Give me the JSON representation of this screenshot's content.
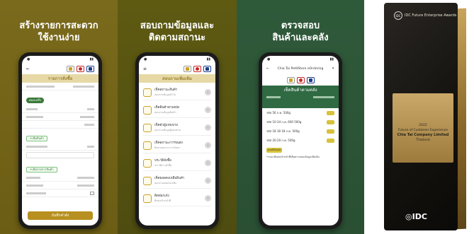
{
  "panels": [
    {
      "heading": [
        "สร้างรายการสะดวก",
        "ใช้งานง่าย"
      ],
      "screen": {
        "title": "รายการสั่งซื้อ",
        "chip": "คนละครึ่ง",
        "btn1": "+เพิ่มสินค้า",
        "btn2": "+เพิ่มรายการสินค้า",
        "primary": "บันทึกคำสั่ง"
      }
    },
    {
      "heading": [
        "สอบถามข้อมูลและ",
        "ติดตามสถานะ"
      ],
      "screen": {
        "title": "สอบถามเพิ่มเติม",
        "items": [
          {
            "label": "เช็คสถานะสินค้า",
            "sub": "สอบถามข้อมูลทั่วไป"
          },
          {
            "label": "เช็คสินค้าตามคลัง",
            "sub": "สอบถามข้อมูลสินค้า"
          },
          {
            "label": "เช็คตัวผู้แทนขาย",
            "sub": "สอบถามข้อมูลผู้แทนขาย"
          },
          {
            "label": "เช็คสถานะการขนส่ง",
            "sub": "ติดตามสถานะการจัดส่ง"
          },
          {
            "label": "ประวัติสั่งซื้อ",
            "sub": "ประวัติการสั่งซื้อ"
          },
          {
            "label": "เช็คยอดคงเหลือสินค้า",
            "sub": "สอบถามยอดคงเหลือ"
          },
          {
            "label": "ติดต่อ/แจ้ง",
            "sub": "ติดต่อเจ้าหน้าที่"
          }
        ]
      }
    },
    {
      "heading": [
        "ตรวจสอบ",
        "สินค้าและคลัง"
      ],
      "screen": {
        "app_title": "Chia Tai PetitStore eOrdering",
        "title": "เช็คสินค้าตามคลัง",
        "rows": [
          "รหัส 56 ก.ค. 500g",
          "รหัส 10-34 ก.ค. 600 500g",
          "รหัส 18 18 18 ก.ค. 500g",
          "รหัส 20-20 ก.ค. 500g"
        ],
        "section": "คงเหลือในคลัง",
        "note": "*กรุณาติดต่อเจ้าหน้าที่เพื่อตรวจสอบข้อมูลเพิ่มเติม"
      }
    }
  ],
  "award": {
    "org": "IDC Future Enterprise Awards",
    "year": "2022",
    "category": "Future of Customer Experience",
    "company": "Chia Tai Company Limited",
    "country": "Thailand",
    "logo": "IDC"
  }
}
